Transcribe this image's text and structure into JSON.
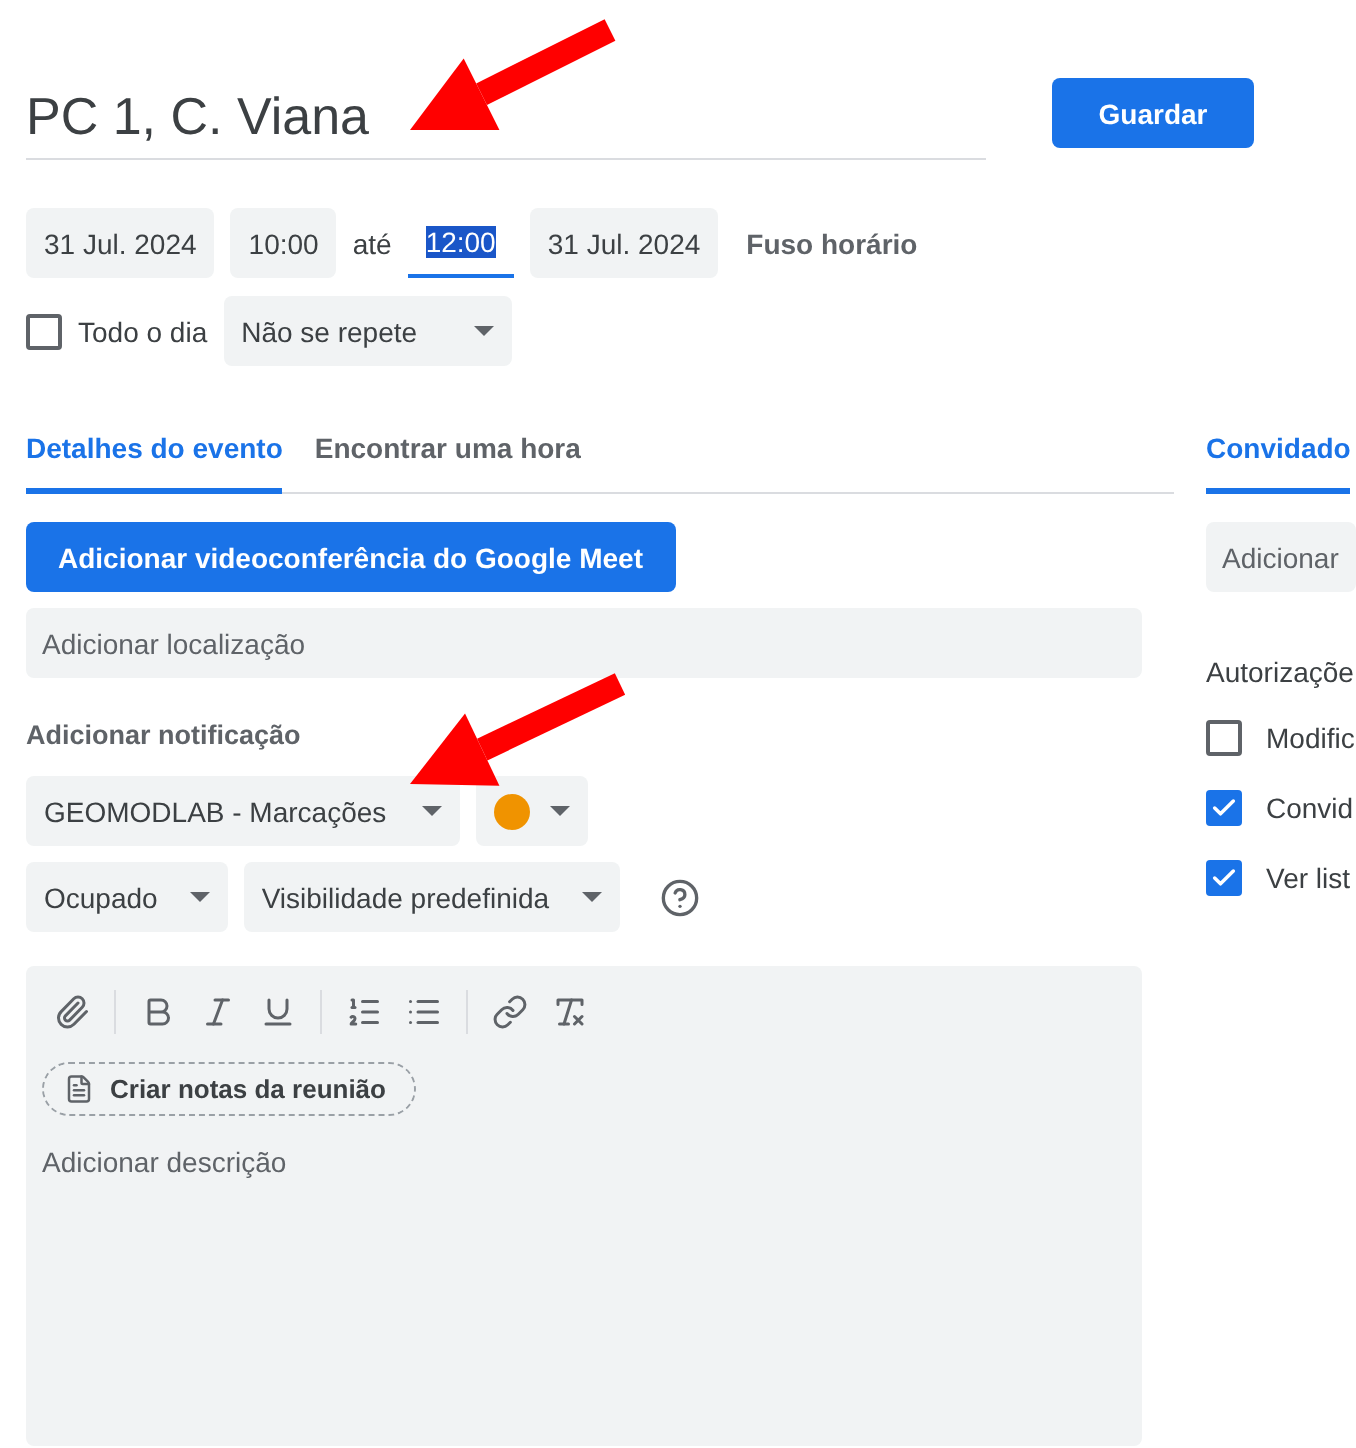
{
  "title": {
    "value": "PC 1, C. Viana"
  },
  "save_button": "Guardar",
  "date_row": {
    "start_date": "31 Jul. 2024",
    "start_time": "10:00",
    "separator": "até",
    "end_time": "12:00",
    "end_time_selected": true,
    "end_date": "31 Jul. 2024",
    "timezone": "Fuso horário"
  },
  "all_day": {
    "label": "Todo o dia",
    "checked": false
  },
  "repeat": "Não se repete",
  "tabs": [
    {
      "label": "Detalhes do evento",
      "selected": true
    },
    {
      "label": "Encontrar uma hora",
      "selected": false
    }
  ],
  "meet_button": "Adicionar videoconferência do Google Meet",
  "location": {
    "placeholder": "Adicionar localização"
  },
  "notification_link": "Adicionar notificação",
  "calendar": "GEOMODLAB - Marcações",
  "event_color": {
    "color": "#f09300"
  },
  "availability": "Ocupado",
  "visibility": "Visibilidade predefinida",
  "toolbar": [
    {
      "kind": "attach"
    },
    {
      "kind": "sep"
    },
    {
      "kind": "bold"
    },
    {
      "kind": "italic"
    },
    {
      "kind": "underline"
    },
    {
      "kind": "sep"
    },
    {
      "kind": "numbered"
    },
    {
      "kind": "bulleted"
    },
    {
      "kind": "sep"
    },
    {
      "kind": "link"
    },
    {
      "kind": "clear"
    }
  ],
  "notes_chip": "Criar notas da reunião",
  "description": {
    "placeholder": "Adicionar descrição"
  },
  "guests_panel": {
    "tab": {
      "label": "Convidado",
      "selected": true
    },
    "field": {
      "placeholder": "Adicionar"
    },
    "permissions_title": "Autorizaçõe",
    "permissions": [
      {
        "label": "Modific",
        "checked": false
      },
      {
        "label": "Convid",
        "checked": true
      },
      {
        "label": "Ver list",
        "checked": true
      }
    ]
  },
  "annotations": [
    {
      "kind": "arrow"
    },
    {
      "kind": "arrow"
    }
  ]
}
